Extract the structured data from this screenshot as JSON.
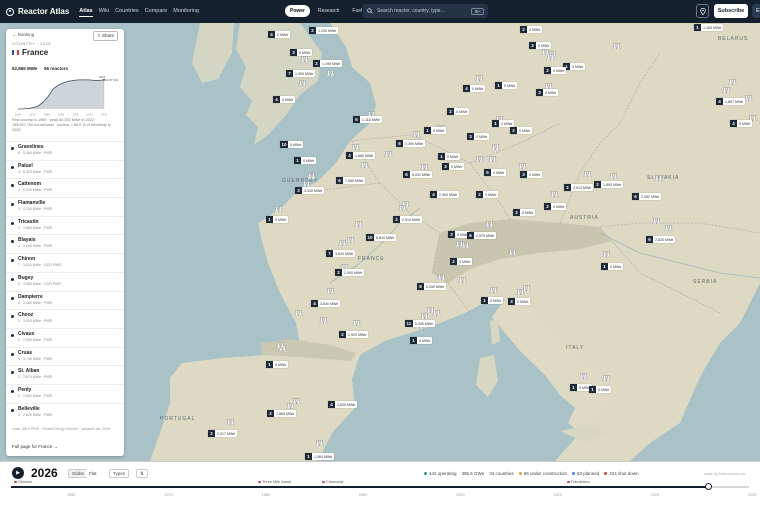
{
  "app": {
    "name": "Reactor Atlas",
    "nav": [
      "Atlas",
      "Wiki",
      "Countries",
      "Compare",
      "Monitoring"
    ],
    "active_nav": "Atlas",
    "modes": [
      "Power",
      "Research",
      "Fuel"
    ],
    "active_mode": "Power",
    "search": {
      "placeholder": "Search reactor, country, type...",
      "shortcut": "⌘K"
    },
    "subscribe_label": "Subscribe",
    "avatar_initial": "E"
  },
  "panel": {
    "back_label": "Ranking",
    "share_label": "Share",
    "kicker": "COUNTRY · 2026",
    "country": "France",
    "flag_colors": [
      "#1f4fa8",
      "#ffffff",
      "#d53b3b"
    ],
    "capacity": "62,865 MWe",
    "reactors": "56 reactors",
    "chart": {
      "years": [
        "1960",
        "1970",
        "1980",
        "1990",
        "2000",
        "2010",
        "2020"
      ],
      "peak_label": "2026",
      "peak_value": "62.87 GW",
      "series": [
        0,
        0.2,
        1.0,
        3.0,
        6.5,
        15,
        28,
        44,
        52,
        57,
        60,
        62,
        63,
        63,
        63,
        62,
        62,
        63
      ],
      "y_max": 65,
      "fill_color": "#cfd4db",
      "line_color": "#3d4d62"
    },
    "summary": "First country in 1959 · peak 62,252 MWe in 2022 · 195,567,750 households · nuclear = 68.0 % of electricity in 2025",
    "plants": [
      {
        "name": "Gravelines",
        "meta": "6 · 5,460 MWe · PWR"
      },
      {
        "name": "Paluel",
        "meta": "4 · 5,320 MWe · PWR"
      },
      {
        "name": "Cattenom",
        "meta": "4 · 5,200 MWe · PWR"
      },
      {
        "name": "Flamanville",
        "meta": "3 · 4,230 MWe · PWR"
      },
      {
        "name": "Tricastin",
        "meta": "4 · 3,660 MWe · PWR"
      },
      {
        "name": "Blayais",
        "meta": "4 · 3,640 MWe · PWR"
      },
      {
        "name": "Chinon",
        "meta": "7 · 3,620 MWe · GCR,PWR"
      },
      {
        "name": "Bugey",
        "meta": "5 · 3,580 MWe · GCR,PWR"
      },
      {
        "name": "Dampierre",
        "meta": "4 · 3,560 MWe · PWR"
      },
      {
        "name": "Chooz",
        "meta": "3 · 3,000 MWe · PWR"
      },
      {
        "name": "Civaux",
        "meta": "2 · 2,990 MWe · PWR"
      },
      {
        "name": "Cruas",
        "meta": "4 · 3,745 MWe · PWR"
      },
      {
        "name": "St. Alban",
        "meta": "2 · 2,670 MWe · PWR"
      },
      {
        "name": "Penly",
        "meta": "2 · 2,660 MWe · PWR"
      },
      {
        "name": "Belleville",
        "meta": "2 · 2,620 MWe · PWR"
      }
    ],
    "source": "Data: IAEA PRIS · Global Energy Monitor · updated Jan 2026",
    "full_page_label": "Full page for France →"
  },
  "map": {
    "labels": [
      "BELARUS",
      "FRANCE",
      "AUSTRIA",
      "SLOVAKIA",
      "SERBIA",
      "ITALY",
      "PORTUGAL",
      "GUERNSEY"
    ],
    "markers": [
      {
        "count": "4",
        "mw": "0 MWe"
      },
      {
        "count": "2",
        "mw": "1,200 MWe"
      },
      {
        "count": "3",
        "mw": "0 MWe"
      },
      {
        "count": "2",
        "mw": "1,195 MWe"
      },
      {
        "count": "7",
        "mw": "1,000 MWe"
      },
      {
        "count": "4",
        "mw": "0 MWe"
      },
      {
        "count": "2",
        "mw": "0 MWe"
      },
      {
        "count": "3",
        "mw": "0 MWe"
      },
      {
        "count": "4",
        "mw": "0 MWe"
      },
      {
        "count": "3",
        "mw": "0 MWe"
      },
      {
        "count": "1",
        "mw": "0 MWe"
      },
      {
        "count": "6",
        "mw": "1,116 MWe"
      },
      {
        "count": "2",
        "mw": "0 MWe"
      },
      {
        "count": "1",
        "mw": "0 MWe"
      },
      {
        "count": "3",
        "mw": "0 MWe"
      },
      {
        "count": "2",
        "mw": "0 MWe"
      },
      {
        "count": "10",
        "mw": "0 MWe"
      },
      {
        "count": "1",
        "mw": "0 MWe"
      },
      {
        "count": "4",
        "mw": "1,660 MWe"
      },
      {
        "count": "6",
        "mw": "2,390 MWe"
      },
      {
        "count": "1",
        "mw": "0 MWe"
      },
      {
        "count": "6",
        "mw": "7,060 MWe"
      },
      {
        "count": "6",
        "mw": "6,031 MWe"
      },
      {
        "count": "3",
        "mw": "0 MWe"
      },
      {
        "count": "5",
        "mw": "0 MWe"
      },
      {
        "count": "3",
        "mw": "3,330 MWe"
      },
      {
        "count": "4",
        "mw": "2,300 MWe"
      },
      {
        "count": "2",
        "mw": "0 MWe"
      },
      {
        "count": "3",
        "mw": "0 MWe"
      },
      {
        "count": "2",
        "mw": "2,913 MWe"
      },
      {
        "count": "3",
        "mw": "0 MWe"
      },
      {
        "count": "2",
        "mw": "0 MWe"
      },
      {
        "count": "2",
        "mw": "1,800 MWe"
      },
      {
        "count": "6",
        "mw": "2,082 MWe"
      },
      {
        "count": "1",
        "mw": "0 MWe"
      },
      {
        "count": "2",
        "mw": "2,910 MWe"
      },
      {
        "count": "10",
        "mw": "8,810 MWe"
      },
      {
        "count": "3",
        "mw": "0 MWe"
      },
      {
        "count": "6",
        "mw": "2,975 MWe"
      },
      {
        "count": "6",
        "mw": "2,820 MWe"
      },
      {
        "count": "7",
        "mw": "3,620 MWe"
      },
      {
        "count": "2",
        "mw": "2,900 MWe"
      },
      {
        "count": "2",
        "mw": "0 MWe"
      },
      {
        "count": "1",
        "mw": "0 MWe"
      },
      {
        "count": "8",
        "mw": "6,250 MWe"
      },
      {
        "count": "4",
        "mw": "3,640 MWe"
      },
      {
        "count": "1",
        "mw": "0 MWe"
      },
      {
        "count": "3",
        "mw": "0 MWe"
      },
      {
        "count": "11",
        "mw": "5,405 MWe"
      },
      {
        "count": "2",
        "mw": "2,920 MWe"
      },
      {
        "count": "1",
        "mw": "0 MWe"
      },
      {
        "count": "1",
        "mw": "0 MWe"
      },
      {
        "count": "1",
        "mw": "0 MWe"
      },
      {
        "count": "4",
        "mw": "3,830 MWe"
      },
      {
        "count": "2",
        "mw": "1,865 MWe"
      },
      {
        "count": "2",
        "mw": "2,917 MWe"
      },
      {
        "count": "1",
        "mw": "1,064 MWe"
      },
      {
        "count": "4",
        "mw": "1,857 MWe"
      },
      {
        "count": "4",
        "mw": "0 MWe"
      },
      {
        "count": "1",
        "mw": "1,160 MWe"
      },
      {
        "count": "1",
        "mw": "0 MWe"
      },
      {
        "count": "1",
        "mw": "0 MWe"
      },
      {
        "count": "1",
        "mw": "0 MWe"
      },
      {
        "count": "2",
        "mw": "0 MWe"
      }
    ]
  },
  "timeline": {
    "year": "2026",
    "toggle": [
      "Globe",
      "Flat"
    ],
    "active_toggle": "Globe",
    "types_label": "Types",
    "stats": [
      {
        "text": "442 operating",
        "color": "#2f9b6b"
      },
      {
        "text": "395.5 GWe",
        "color": ""
      },
      {
        "text": "34 countries",
        "color": ""
      },
      {
        "text": "66 under construction",
        "color": "#e0a235"
      },
      {
        "text": "63 planned",
        "color": "#4a8ad8"
      },
      {
        "text": "224 shut down",
        "color": "#c64545"
      }
    ],
    "credit": "made by Zentronomia.com",
    "events": [
      "Obninsk",
      "Three Mile Island",
      "Chernobyl",
      "Fukushima"
    ],
    "ticks": [
      "1960",
      "1970",
      "1980",
      "1990",
      "2000",
      "2010",
      "2020",
      "2030"
    ],
    "progress": 0.944
  }
}
